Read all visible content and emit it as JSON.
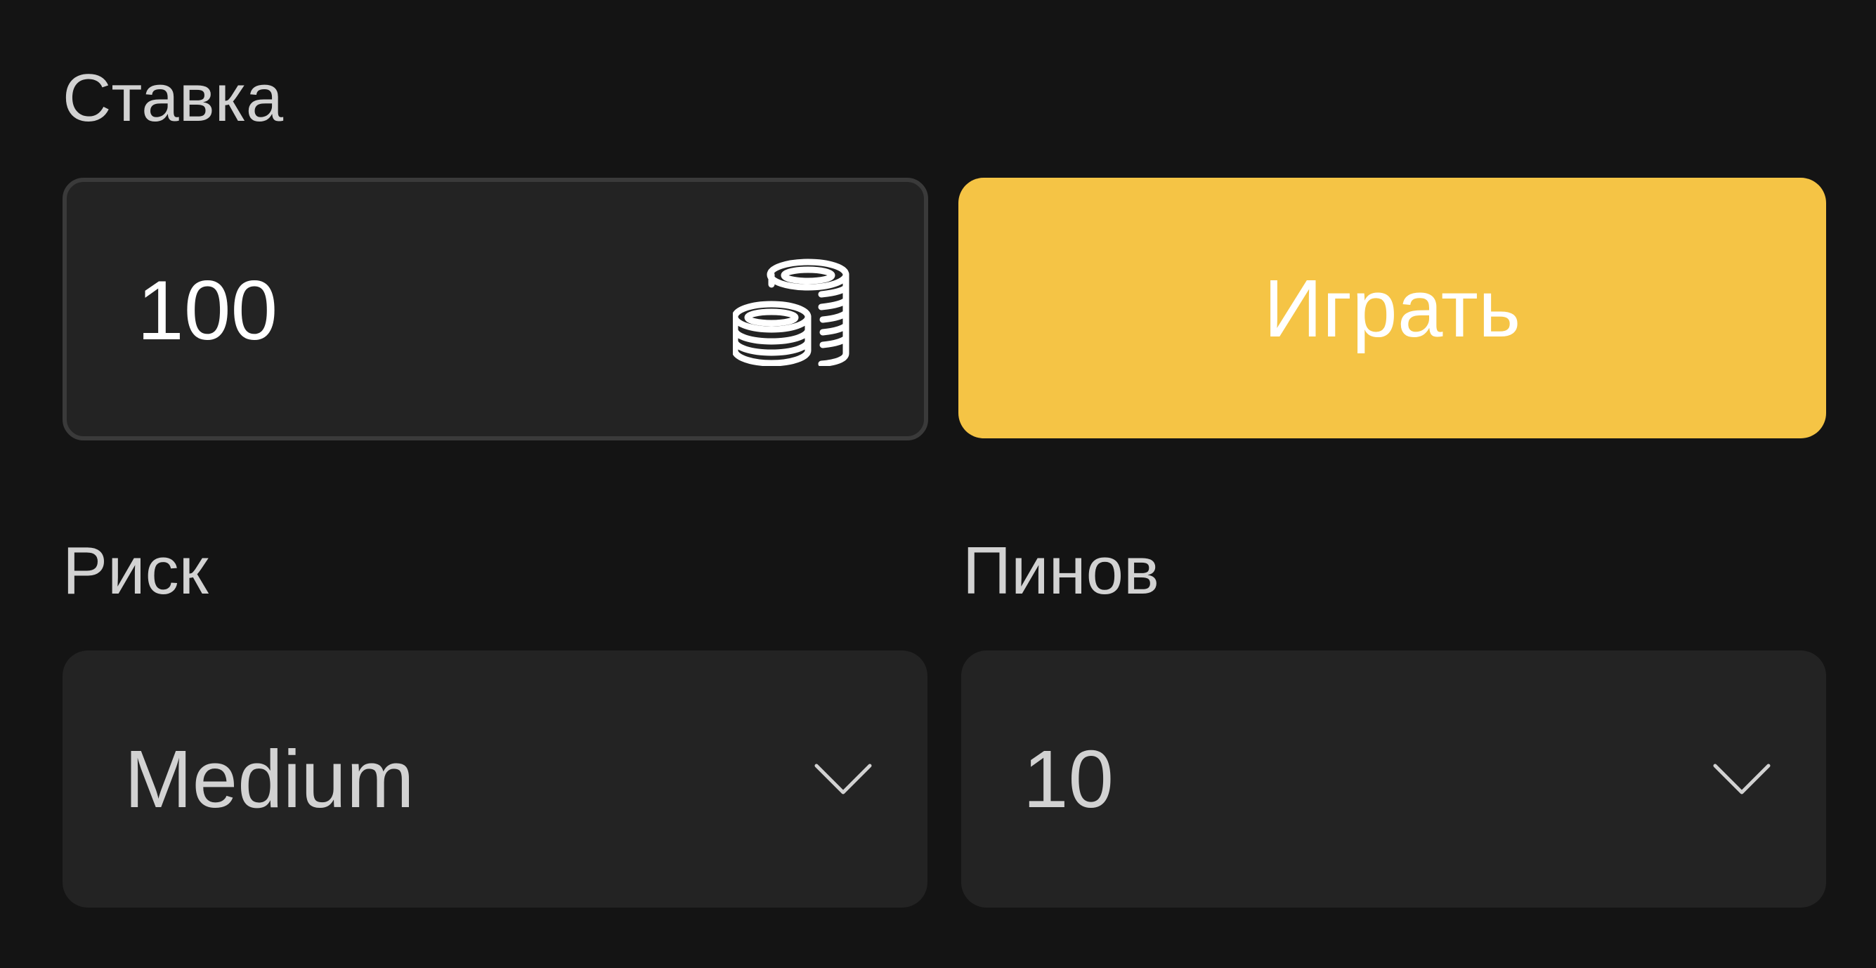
{
  "stake": {
    "label": "Ставка",
    "value": "100",
    "icon": "coins-icon"
  },
  "play_button": {
    "label": "Играть",
    "color": "#f5c445"
  },
  "risk": {
    "label": "Риск",
    "selected": "Medium",
    "icon": "chevron-down-icon"
  },
  "pins": {
    "label": "Пинов",
    "selected": "10",
    "icon": "chevron-down-icon"
  },
  "colors": {
    "background": "#141414",
    "field": "#232323",
    "field_border": "#3a3a3a",
    "label_text": "#d2d2d2",
    "accent": "#f5c445"
  }
}
